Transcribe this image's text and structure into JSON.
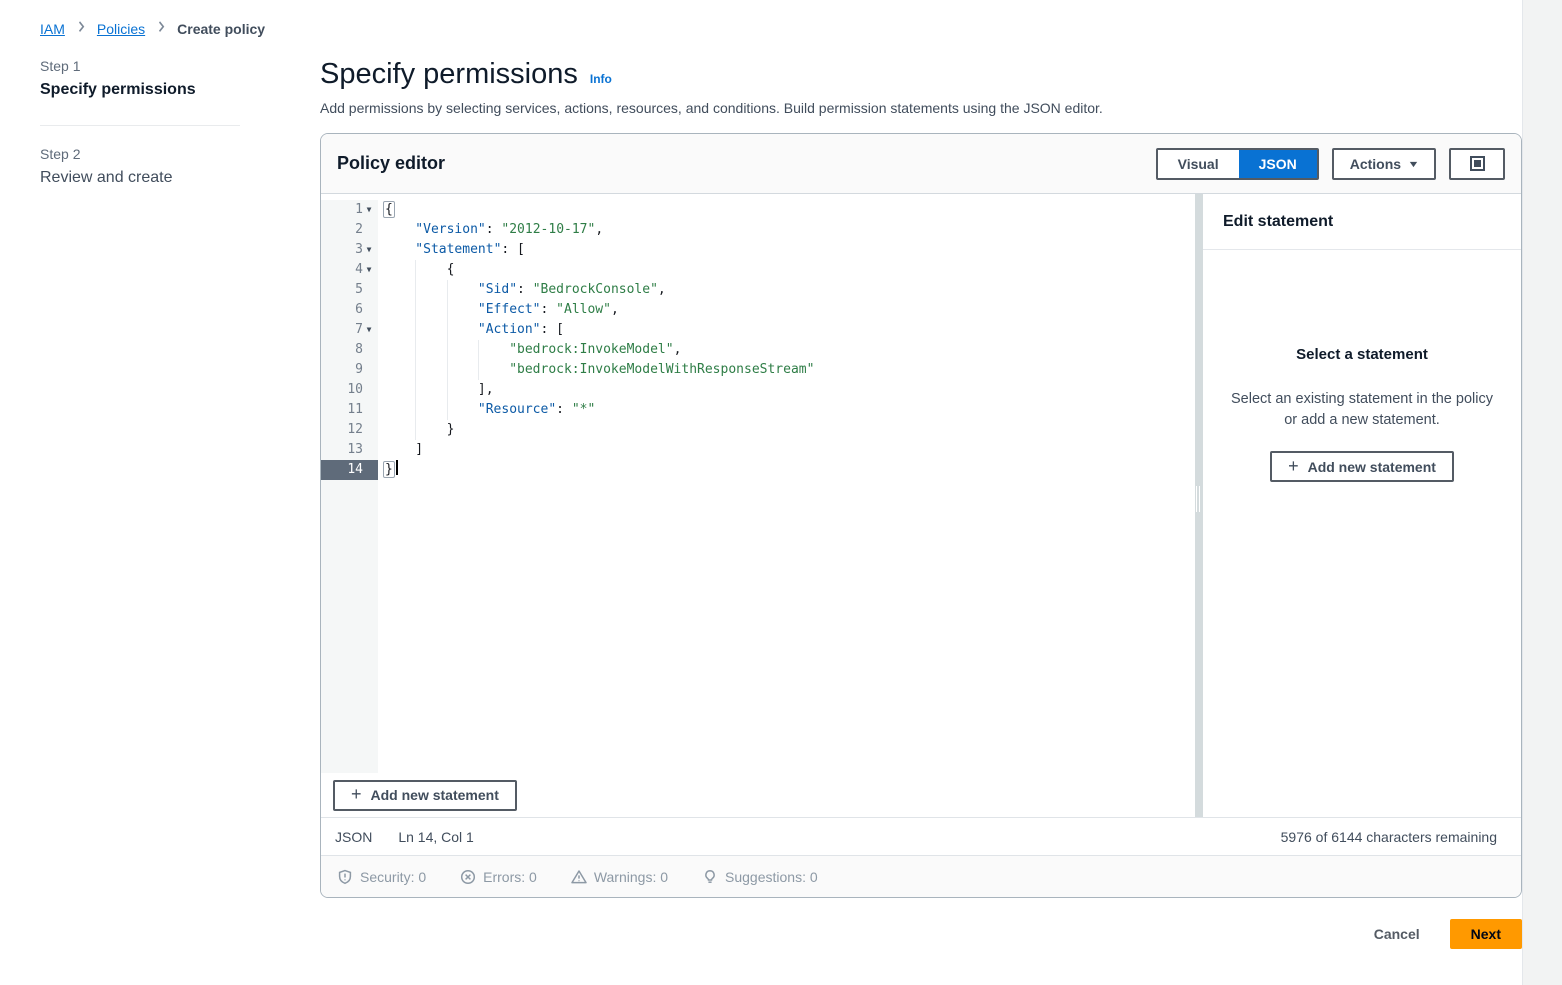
{
  "breadcrumb": {
    "items": [
      {
        "label": "IAM",
        "link": true
      },
      {
        "label": "Policies",
        "link": true
      },
      {
        "label": "Create policy",
        "link": false
      }
    ]
  },
  "steps": [
    {
      "step": "Step 1",
      "title": "Specify permissions",
      "active": true
    },
    {
      "step": "Step 2",
      "title": "Review and create",
      "active": false
    }
  ],
  "header": {
    "title": "Specify permissions",
    "info_label": "Info",
    "description": "Add permissions by selecting services, actions, resources, and conditions. Build permission statements using the JSON editor."
  },
  "policy_editor": {
    "title": "Policy editor",
    "toggle": {
      "visual_label": "Visual",
      "json_label": "JSON",
      "selected": "JSON"
    },
    "actions_label": "Actions",
    "expand_icon": "expand-icon",
    "add_statement_label": "Add new statement",
    "status": {
      "mode": "JSON",
      "position": "Ln 14, Col 1",
      "chars_remaining": "5976 of 6144 characters remaining"
    },
    "issues": [
      {
        "icon": "shield-icon",
        "label": "Security: 0"
      },
      {
        "icon": "error-circle-icon",
        "label": "Errors: 0"
      },
      {
        "icon": "warning-triangle-icon",
        "label": "Warnings: 0"
      },
      {
        "icon": "lightbulb-icon",
        "label": "Suggestions: 0"
      }
    ],
    "code_lines": [
      {
        "n": 1,
        "indent": 0,
        "fold": true,
        "tokens": [
          {
            "t": "pb",
            "v": "{"
          }
        ]
      },
      {
        "n": 2,
        "indent": 1,
        "tokens": [
          {
            "t": "key",
            "v": "\"Version\""
          },
          {
            "t": "pun",
            "v": ": "
          },
          {
            "t": "str",
            "v": "\"2012-10-17\""
          },
          {
            "t": "pun",
            "v": ","
          }
        ]
      },
      {
        "n": 3,
        "indent": 1,
        "fold": true,
        "tokens": [
          {
            "t": "key",
            "v": "\"Statement\""
          },
          {
            "t": "pun",
            "v": ": ["
          }
        ]
      },
      {
        "n": 4,
        "indent": 2,
        "fold": true,
        "tokens": [
          {
            "t": "pun",
            "v": "{"
          }
        ]
      },
      {
        "n": 5,
        "indent": 3,
        "tokens": [
          {
            "t": "key",
            "v": "\"Sid\""
          },
          {
            "t": "pun",
            "v": ": "
          },
          {
            "t": "str",
            "v": "\"BedrockConsole\""
          },
          {
            "t": "pun",
            "v": ","
          }
        ]
      },
      {
        "n": 6,
        "indent": 3,
        "tokens": [
          {
            "t": "key",
            "v": "\"Effect\""
          },
          {
            "t": "pun",
            "v": ": "
          },
          {
            "t": "str",
            "v": "\"Allow\""
          },
          {
            "t": "pun",
            "v": ","
          }
        ]
      },
      {
        "n": 7,
        "indent": 3,
        "fold": true,
        "tokens": [
          {
            "t": "key",
            "v": "\"Action\""
          },
          {
            "t": "pun",
            "v": ": ["
          }
        ]
      },
      {
        "n": 8,
        "indent": 4,
        "tokens": [
          {
            "t": "str",
            "v": "\"bedrock:InvokeModel\""
          },
          {
            "t": "pun",
            "v": ","
          }
        ]
      },
      {
        "n": 9,
        "indent": 4,
        "tokens": [
          {
            "t": "str",
            "v": "\"bedrock:InvokeModelWithResponseStream\""
          }
        ]
      },
      {
        "n": 10,
        "indent": 3,
        "tokens": [
          {
            "t": "pun",
            "v": "],"
          }
        ]
      },
      {
        "n": 11,
        "indent": 3,
        "tokens": [
          {
            "t": "key",
            "v": "\"Resource\""
          },
          {
            "t": "pun",
            "v": ": "
          },
          {
            "t": "str",
            "v": "\"*\""
          }
        ]
      },
      {
        "n": 12,
        "indent": 2,
        "tokens": [
          {
            "t": "pun",
            "v": "}"
          }
        ]
      },
      {
        "n": 13,
        "indent": 1,
        "tokens": [
          {
            "t": "pun",
            "v": "]"
          }
        ]
      },
      {
        "n": 14,
        "indent": 0,
        "active": true,
        "cursor": true,
        "tokens": [
          {
            "t": "pb",
            "v": "}"
          }
        ]
      }
    ]
  },
  "edit_statement_panel": {
    "title": "Edit statement",
    "empty_title": "Select a statement",
    "empty_description": "Select an existing statement in the policy or add a new statement.",
    "add_statement_label": "Add new statement"
  },
  "footer": {
    "cancel_label": "Cancel",
    "next_label": "Next"
  },
  "colors": {
    "accent": "#0972d3",
    "next_button": "#ff9900",
    "code_key": "#0c5aa6",
    "code_string": "#2e7d46",
    "active_gutter": "#5f6b7a"
  }
}
